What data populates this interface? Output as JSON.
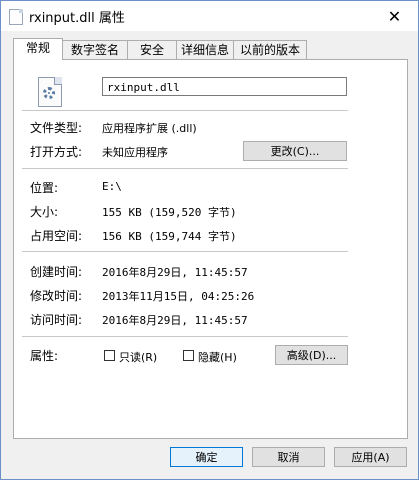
{
  "window": {
    "title": "rxinput.dll 属性",
    "close_glyph": "✕"
  },
  "tabs": [
    {
      "label": "常规"
    },
    {
      "label": "数字签名"
    },
    {
      "label": "安全"
    },
    {
      "label": "详细信息"
    },
    {
      "label": "以前的版本"
    }
  ],
  "general": {
    "file_name": "rxinput.dll",
    "type_label": "文件类型:",
    "type_value": "应用程序扩展 (.dll)",
    "open_with_label": "打开方式:",
    "open_with_value": "未知应用程序",
    "change_button": "更改(C)...",
    "location_label": "位置:",
    "location_value": "E:\\",
    "size_label": "大小:",
    "size_value": "155 KB (159,520 字节)",
    "size_on_disk_label": "占用空间:",
    "size_on_disk_value": "156 KB (159,744 字节)",
    "created_label": "创建时间:",
    "created_value": "2016年8月29日, 11:45:57",
    "modified_label": "修改时间:",
    "modified_value": "2013年11月15日, 04:25:26",
    "accessed_label": "访问时间:",
    "accessed_value": "2016年8月29日, 11:45:57",
    "attributes_label": "属性:",
    "readonly_label": "只读(R)",
    "readonly_checked": false,
    "hidden_label": "隐藏(H)",
    "hidden_checked": false,
    "advanced_button": "高级(D)..."
  },
  "footer": {
    "ok": "确定",
    "cancel": "取消",
    "apply": "应用(A)"
  },
  "icons": {
    "title": "dll-file-icon",
    "file": "dll-file-gear-icon"
  }
}
